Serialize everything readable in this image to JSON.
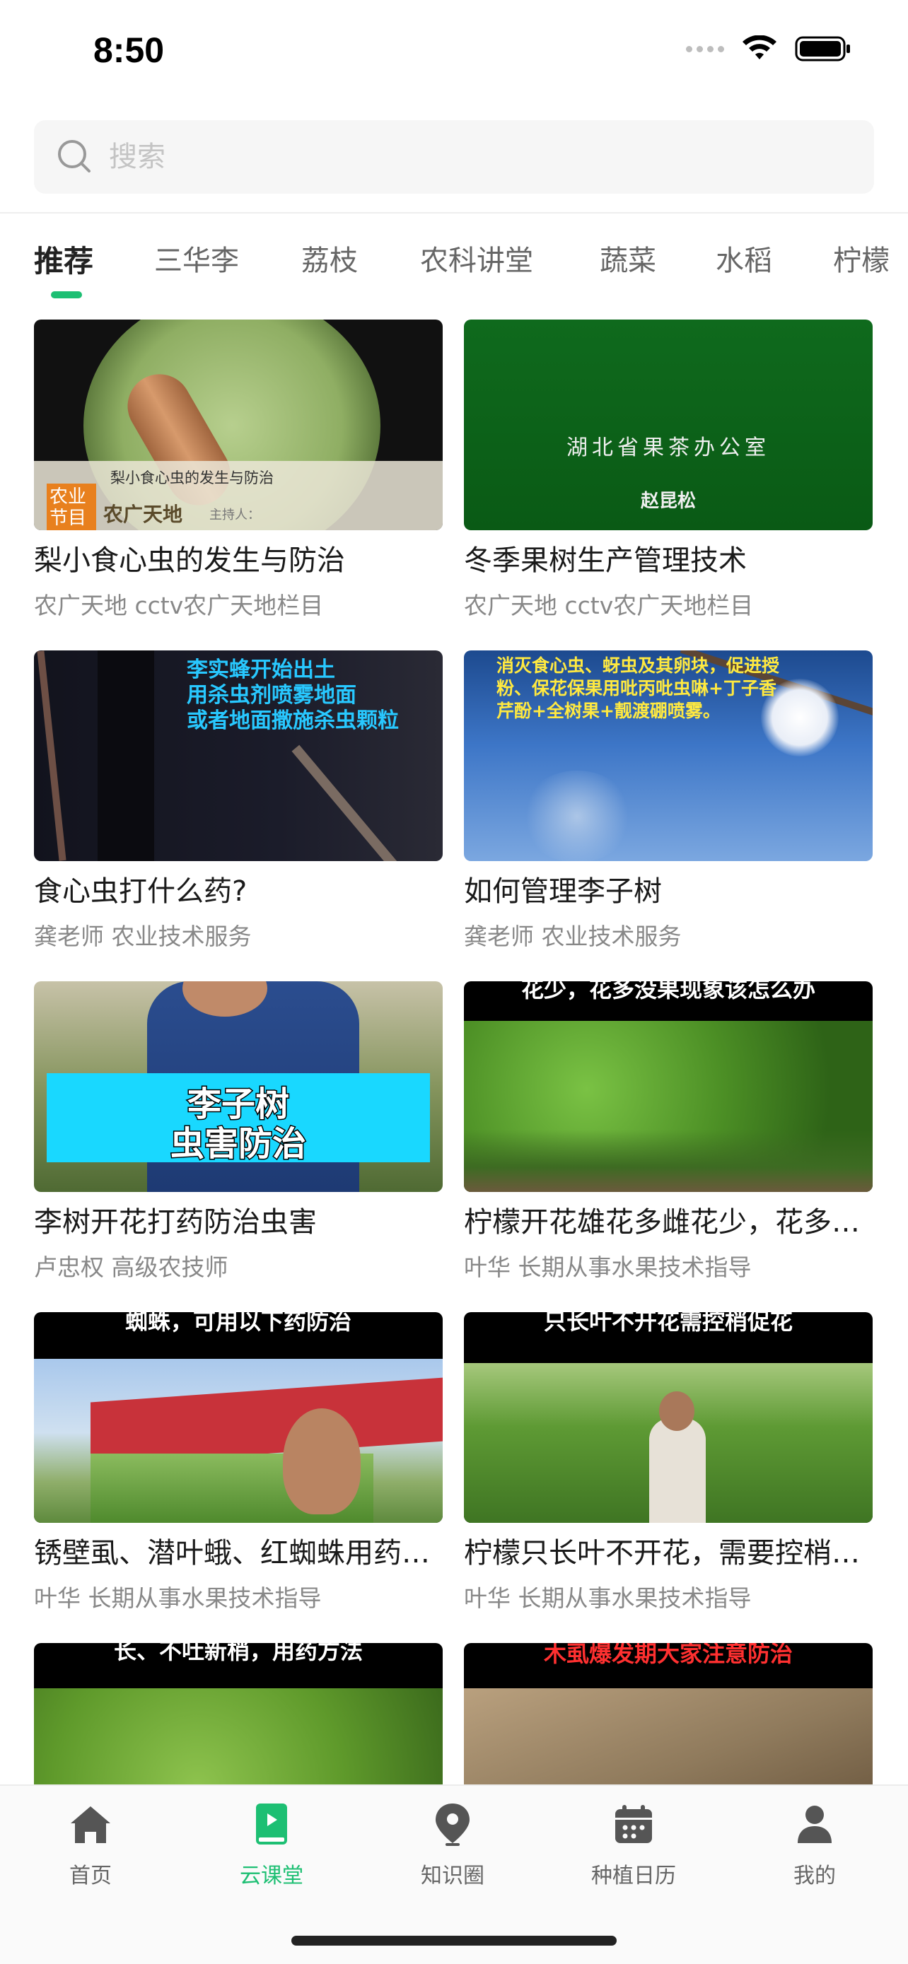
{
  "status": {
    "time": "8:50"
  },
  "search": {
    "placeholder": "搜索"
  },
  "tabs": [
    {
      "label": "推荐",
      "active": true
    },
    {
      "label": "三华李"
    },
    {
      "label": "荔枝"
    },
    {
      "label": "农科讲堂"
    },
    {
      "label": "蔬菜"
    },
    {
      "label": "水稻"
    },
    {
      "label": "柠檬"
    }
  ],
  "cards": [
    {
      "title": "梨小食心虫的发生与防治",
      "subtitle": "农广天地 cctv农广天地栏目",
      "overlay": {
        "caption": "梨小食心虫的发生与防治",
        "badge": "农业节目",
        "show": "农广天地",
        "host": "主持人："
      }
    },
    {
      "title": "冬季果树生产管理技术",
      "subtitle": "农广天地 cctv农广天地栏目",
      "overlay": {
        "org": "湖北省果茶办公室",
        "name": "赵昆松"
      }
    },
    {
      "title": "食心虫打什么药?",
      "subtitle": "龚老师 农业技术服务",
      "overlay": {
        "line1": "李实蜂开始出土",
        "line2": "用杀虫剂喷雾地面",
        "line3": "或者地面撒施杀虫颗粒"
      }
    },
    {
      "title": "如何管理李子树",
      "subtitle": "龚老师 农业技术服务",
      "overlay": {
        "line1": "消灭食心虫、蚜虫及其卵块，促进授",
        "line2": "粉、保花保果用吡丙吡虫啉+丁子香",
        "line3": "芹酚+全树果+靓渡硼喷雾。"
      }
    },
    {
      "title": "李树开花打药防治虫害",
      "subtitle": "卢忠权 高级农技师",
      "overlay": {
        "line1": "李子树",
        "line2": "虫害防治"
      }
    },
    {
      "title": "柠檬开花雄花多雌花少，花多没果现象该怎么办",
      "subtitle": "叶华 长期从事水果技术指导",
      "overlay": {
        "line1": "花少，花多没果现象该怎么办"
      }
    },
    {
      "title": "锈壁虱、潜叶蛾、红蜘蛛用药防治",
      "subtitle": "叶华 长期从事水果技术指导",
      "overlay": {
        "line1": "蜘蛛，可用以下药防治"
      }
    },
    {
      "title": "柠檬只长叶不开花，需要控梢促花",
      "subtitle": "叶华 长期从事水果技术指导",
      "overlay": {
        "line1": "只长叶不开花需控梢促花"
      }
    },
    {
      "title": "",
      "subtitle": "",
      "overlay": {
        "line1": "长、不吐新梢，用药方法"
      }
    },
    {
      "title": "",
      "subtitle": "",
      "overlay": {
        "line1": "木虱爆发期大家注意防治"
      }
    }
  ],
  "nav": [
    {
      "label": "首页",
      "icon": "home-icon"
    },
    {
      "label": "云课堂",
      "icon": "book-icon",
      "active": true
    },
    {
      "label": "知识圈",
      "icon": "location-pin-icon"
    },
    {
      "label": "种植日历",
      "icon": "calendar-icon"
    },
    {
      "label": "我的",
      "icon": "user-icon"
    }
  ],
  "colors": {
    "accent": "#1dbf73",
    "inactive": "#666666"
  }
}
